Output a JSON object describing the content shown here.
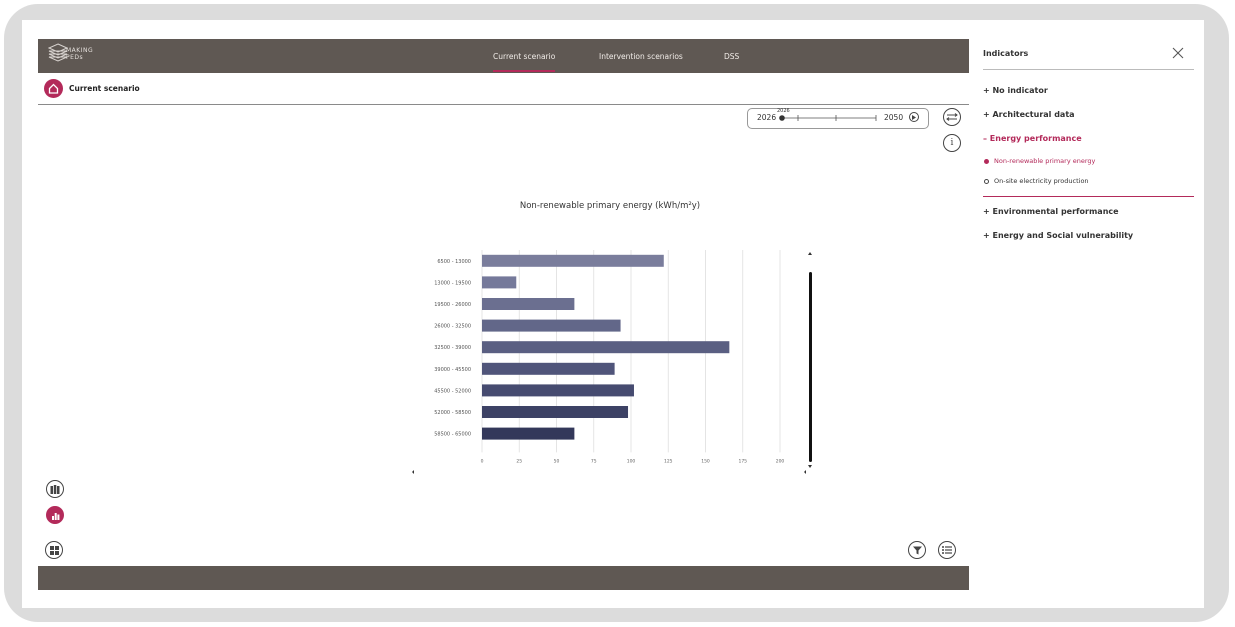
{
  "app": {
    "logo_text_1": "MAKING",
    "logo_text_2": "PEDs"
  },
  "nav": {
    "items": [
      {
        "label": "Current scenario",
        "active": true
      },
      {
        "label": "Intervention scenarios"
      },
      {
        "label": "DSS"
      }
    ]
  },
  "subheader": {
    "title": "Current scenario"
  },
  "year_slider": {
    "start": "2026",
    "current": "2026",
    "end": "2050"
  },
  "panel": {
    "title": "Indicators",
    "items": [
      {
        "label": "+ No indicator"
      },
      {
        "label": "+ Architectural data"
      },
      {
        "label": "– Energy performance",
        "active": true
      },
      {
        "label": "+ Environmental performance"
      },
      {
        "label": "+ Energy and Social vulnerability"
      }
    ],
    "subitems": [
      {
        "label": "Non-renewable primary energy",
        "active": true
      },
      {
        "label": "On-site electricity production"
      }
    ]
  },
  "colors": {
    "accent": "#b32a5a",
    "header": "#5f5853"
  },
  "chart_data": {
    "type": "bar",
    "orientation": "horizontal",
    "title": "Non-renewable primary energy (kWh/m²y)",
    "categories": [
      "6500 - 13000",
      "13000 - 19500",
      "19500 - 26000",
      "26000 - 32500",
      "32500 - 39000",
      "39000 - 45500",
      "45500 - 52000",
      "52000 - 58500",
      "58500 - 65000"
    ],
    "values": [
      122,
      23,
      62,
      93,
      166,
      89,
      102,
      98,
      62
    ],
    "xticks": [
      "0",
      "25",
      "50",
      "75",
      "100",
      "125",
      "150",
      "175",
      "200"
    ],
    "xlim": [
      0,
      200
    ],
    "grid": true
  }
}
